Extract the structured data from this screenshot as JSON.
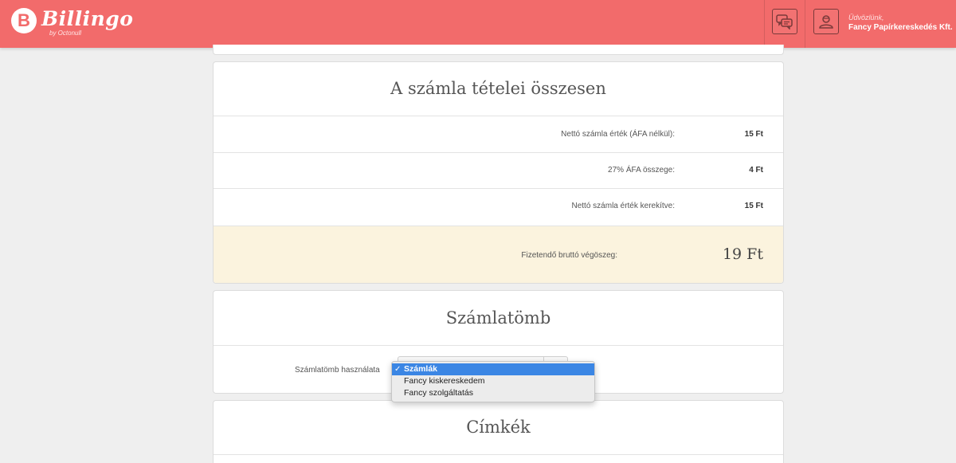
{
  "header": {
    "logo_mark": "B",
    "logo_name": "Billingo",
    "logo_sub": "by Octonull",
    "welcome_greeting": "Üdvözlünk,",
    "company_name": "Fancy Papírkereskedés Kft."
  },
  "totals": {
    "title": "A számla tételei összesen",
    "rows": [
      {
        "label": "Nettó számla érték (ÁFA nélkül):",
        "value": "15 Ft"
      },
      {
        "label": "27% ÁFA összege:",
        "value": "4 Ft"
      },
      {
        "label": "Nettó számla érték kerekítve:",
        "value": "15 Ft"
      }
    ],
    "grand_total_label": "Fizetendő bruttó végöszeg:",
    "grand_total_value": "19 Ft"
  },
  "invoice_pad": {
    "title": "Számlatömb",
    "field_label": "Számlatömb használata",
    "options": [
      "Számlák",
      "Fancy kiskereskedem",
      "Fancy szolgáltatás"
    ],
    "selected_index": 0,
    "check_mark": "✓"
  },
  "tags": {
    "title": "Címkék"
  },
  "colors": {
    "header_bg": "#f26b6b",
    "total_bg": "#fbf3de",
    "selection": "#3b86e4"
  }
}
